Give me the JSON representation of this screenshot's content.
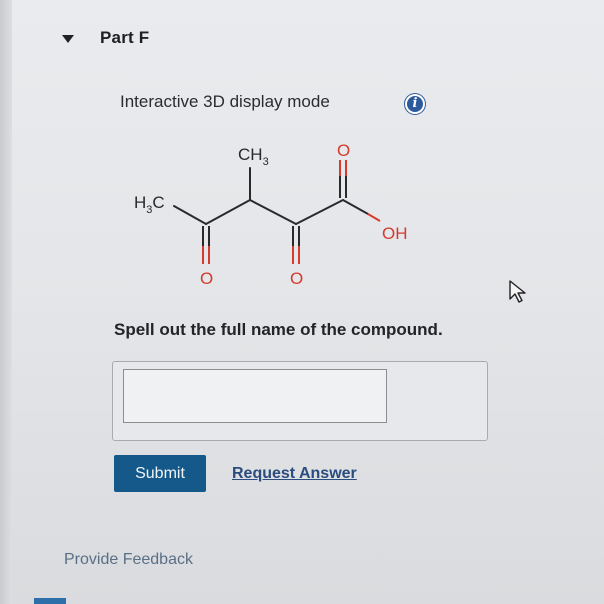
{
  "part": {
    "title": "Part F",
    "collapse_icon": "caret-down-icon"
  },
  "display": {
    "mode_label": "Interactive 3D display mode",
    "info_icon": "info-icon",
    "info_glyph": "i"
  },
  "molecule": {
    "label_ch3": "CH",
    "label_ch3_sub": "3",
    "label_h3c_h": "H",
    "label_h3c_sub": "3",
    "label_h3c_c": "C",
    "label_o_top": "O",
    "label_oh": "OH",
    "label_o_left": "O",
    "label_o_mid": "O",
    "colors": {
      "bond": "#2a2a2a",
      "oxygen": "#d43a2e",
      "text": "#2a2a2a"
    }
  },
  "question": {
    "prompt": "Spell out the full name of the compound.",
    "answer_value": ""
  },
  "actions": {
    "submit_label": "Submit",
    "request_answer_label": "Request Answer",
    "provide_feedback_label": "Provide Feedback"
  },
  "colors": {
    "submit_bg": "#14598a",
    "link": "#2b4c7e",
    "info": "#2d5a9c"
  }
}
